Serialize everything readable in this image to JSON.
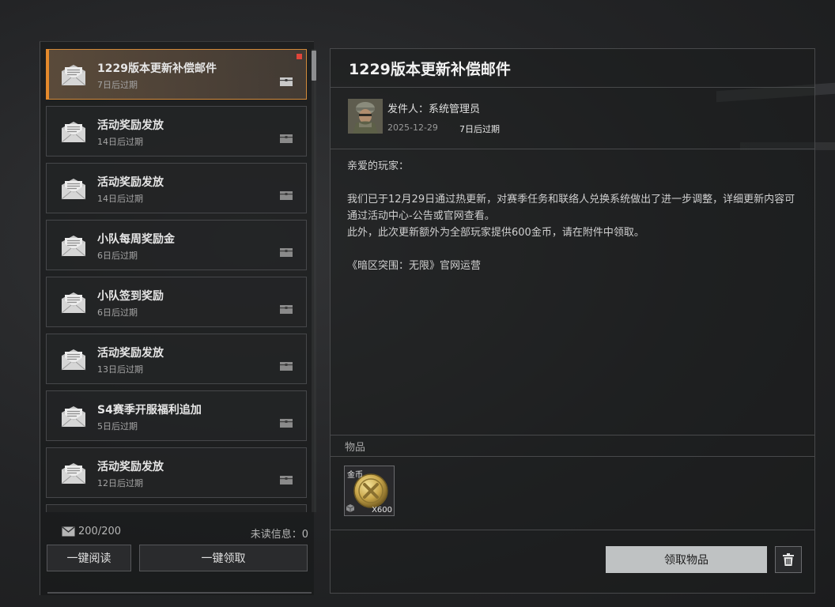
{
  "mail_list": {
    "items": [
      {
        "title": "1229版本更新补偿邮件",
        "expire": "7日后过期",
        "selected": true,
        "unread": true
      },
      {
        "title": "活动奖励发放",
        "expire": "14日后过期"
      },
      {
        "title": "活动奖励发放",
        "expire": "14日后过期"
      },
      {
        "title": "小队每周奖励金",
        "expire": "6日后过期"
      },
      {
        "title": "小队签到奖励",
        "expire": "6日后过期"
      },
      {
        "title": "活动奖励发放",
        "expire": "13日后过期"
      },
      {
        "title": "S4赛季开服福利追加",
        "expire": "5日后过期"
      },
      {
        "title": "活动奖励发放",
        "expire": "12日后过期"
      }
    ]
  },
  "footer": {
    "mailbox_count": "200/200",
    "unread_info": "未读信息：0",
    "read_all_label": "一键阅读",
    "claim_all_label": "一键领取"
  },
  "detail": {
    "title": "1229版本更新补偿邮件",
    "sender_line": "发件人：系统管理员",
    "date": "2025-12-29",
    "expire": "7日后过期",
    "body": {
      "greeting": "亲爱的玩家：",
      "paragraph1": "我们已于12月29日通过热更新，对赛季任务和联络人兑换系统做出了进一步调整，详细更新内容可通过活动中心-公告或官网查看。",
      "paragraph2": "此外，此次更新额外为全部玩家提供600金币，请在附件中领取。",
      "signature": "《暗区突围：无限》官网运营"
    },
    "items_label": "物品",
    "item": {
      "name": "金币",
      "quantity": "X600",
      "icon": "gold-coin-icon"
    },
    "claim_label": "领取物品",
    "delete_icon": "trash-icon"
  },
  "colors": {
    "accent": "#e58a2c",
    "unread_dot": "#e0453a",
    "claim_button": "#bfc2c3"
  }
}
